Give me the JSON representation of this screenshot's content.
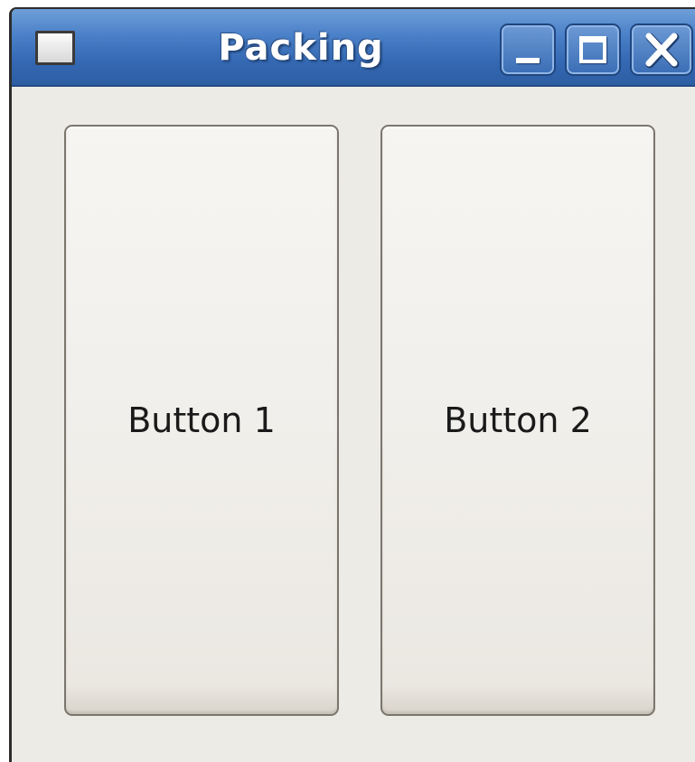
{
  "window": {
    "title": "Packing",
    "icon": "window-icon",
    "controls": {
      "minimize_icon": "minimize-icon",
      "maximize_icon": "maximize-icon",
      "close_icon": "close-icon"
    }
  },
  "content": {
    "buttons": [
      {
        "label": "Button 1"
      },
      {
        "label": "Button 2"
      }
    ]
  },
  "colors": {
    "titlebar": "#4a80c8",
    "window_background": "#edebe6",
    "button_border": "#7b766d"
  }
}
